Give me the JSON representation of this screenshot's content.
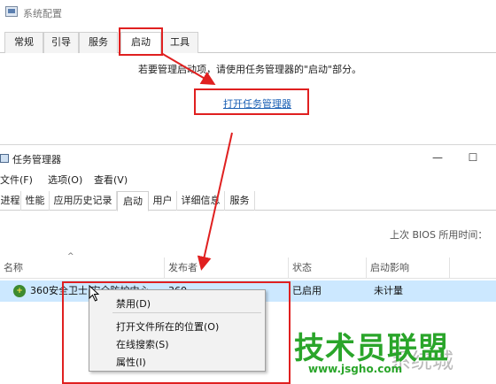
{
  "msconfig": {
    "title": "系统配置",
    "tabs": [
      {
        "label": "常规"
      },
      {
        "label": "引导"
      },
      {
        "label": "服务"
      },
      {
        "label": "启动"
      },
      {
        "label": "工具"
      }
    ],
    "notice": "若要管理启动项，请使用任务管理器的\"启动\"部分。",
    "open_link": "打开任务管理器"
  },
  "taskmgr": {
    "title": "任务管理器",
    "window_buttons": {
      "minimize": "—",
      "maximize": "☐"
    },
    "menus": [
      {
        "label": "文件(F)"
      },
      {
        "label": "选项(O)"
      },
      {
        "label": "查看(V)"
      }
    ],
    "tabs": [
      {
        "label": "进程"
      },
      {
        "label": "性能"
      },
      {
        "label": "应用历史记录"
      },
      {
        "label": "启动"
      },
      {
        "label": "用户"
      },
      {
        "label": "详细信息"
      },
      {
        "label": "服务"
      }
    ],
    "bios_time": "上次 BIOS 所用时间：",
    "sort_arrow": "^",
    "columns": [
      {
        "label": "名称"
      },
      {
        "label": "发布者"
      },
      {
        "label": "状态"
      },
      {
        "label": "启动影响"
      }
    ],
    "rows": [
      {
        "name": "360安全卫士 安全防护中心",
        "publisher": "360",
        "status": "已启用",
        "impact": "未计量"
      }
    ]
  },
  "context_menu": {
    "items": [
      {
        "label": "禁用(D)"
      },
      {
        "label": "打开文件所在的位置(O)"
      },
      {
        "label": "在线搜索(S)"
      },
      {
        "label": "属性(I)"
      }
    ]
  },
  "watermark": {
    "main": "技术员联盟",
    "url": "www.jsgho.com",
    "ghost": "系统城"
  },
  "colors": {
    "annotation_red": "#e02020",
    "selection_blue": "#cce8ff",
    "link_blue": "#1a5fb4",
    "watermark_green": "#2aa52a"
  }
}
